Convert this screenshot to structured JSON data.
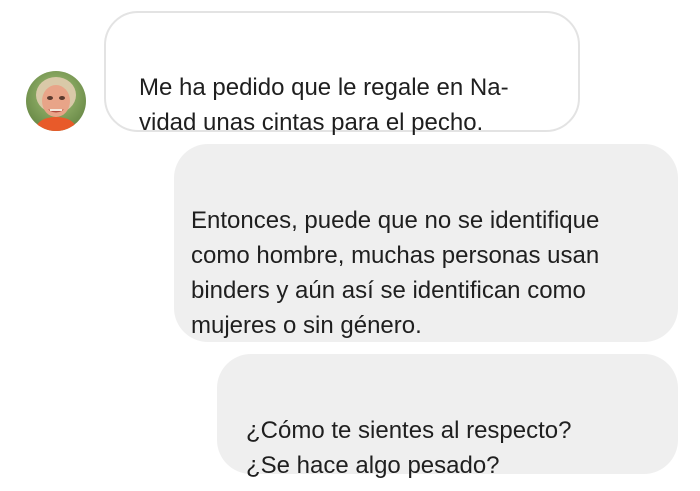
{
  "conversation": {
    "contact": {
      "avatar_icon": "person-avatar-icon"
    },
    "messages": [
      {
        "sender": "contact",
        "text": "Me ha pedido que le regale en Na-\nvidad unas cintas para el pecho."
      },
      {
        "sender": "me",
        "text": "Entonces, puede que no se identifique\ncomo hombre, muchas personas usan\nbinders y aún así se identifican como\nmujeres o sin género."
      },
      {
        "sender": "me",
        "text": "¿Cómo te sientes al respecto?\n¿Se hace algo pesado?"
      }
    ]
  },
  "colors": {
    "incoming_bubble": "#ffffff",
    "incoming_border": "#e3e3e3",
    "outgoing_bubble": "#efefef",
    "text": "#1f1f1f"
  }
}
